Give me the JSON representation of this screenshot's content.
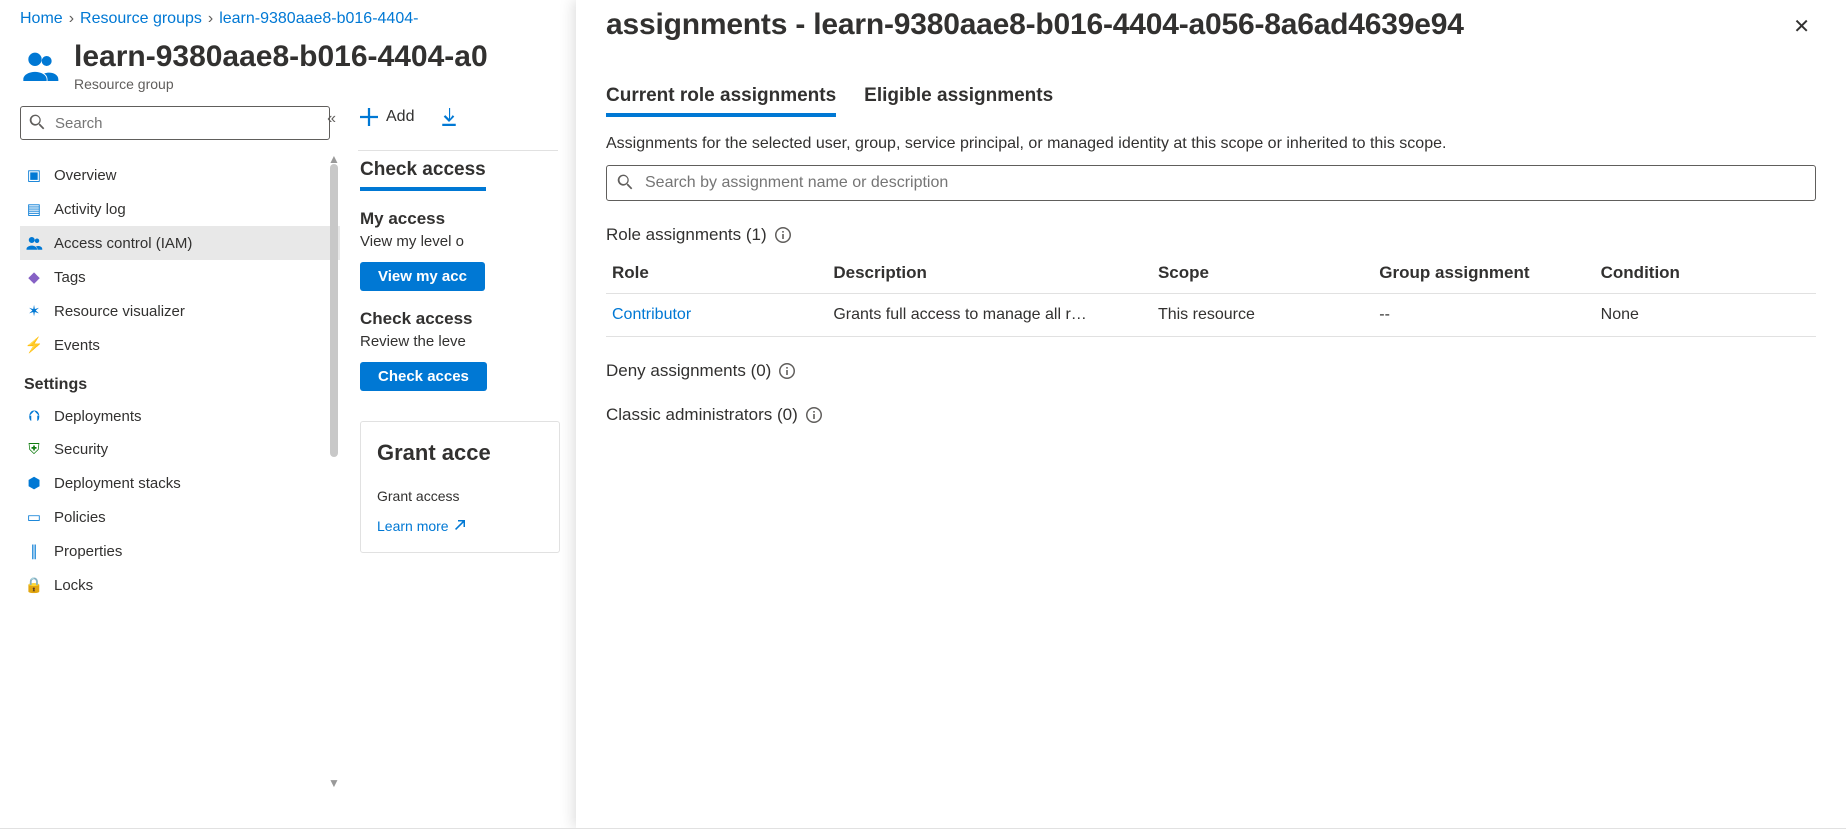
{
  "breadcrumb": {
    "home": "Home",
    "rg": "Resource groups",
    "current": "learn-9380aae8-b016-4404-"
  },
  "page": {
    "title": "learn-9380aae8-b016-4404-a0",
    "subtitle": "Resource group",
    "search_placeholder": "Search"
  },
  "sidebar": {
    "items": {
      "overview": "Overview",
      "activity": "Activity log",
      "iam": "Access control (IAM)",
      "tags": "Tags",
      "visualizer": "Resource visualizer",
      "events": "Events"
    },
    "settings_heading": "Settings",
    "settings_items": {
      "deployments": "Deployments",
      "security": "Security",
      "stacks": "Deployment stacks",
      "policies": "Policies",
      "properties": "Properties",
      "locks": "Locks"
    }
  },
  "toolbar": {
    "add": "Add"
  },
  "mid": {
    "tab": "Check access",
    "my_access_h": "My access",
    "my_access_p": "View my level o",
    "my_access_btn": "View my acc",
    "check_h": "Check access",
    "check_p": "Review the leve",
    "check_btn": "Check acces",
    "grant_h": "Grant acce",
    "grant_p": "Grant access ",
    "learn_more": "Learn more"
  },
  "panel": {
    "title": "assignments - learn-9380aae8-b016-4404-a056-8a6ad4639e94",
    "tabs": {
      "current": "Current role assignments",
      "eligible": "Eligible assignments"
    },
    "desc": "Assignments for the selected user, group, service principal, or managed identity at this scope or inherited to this scope.",
    "search_placeholder": "Search by assignment name or description",
    "role_heading": "Role assignments (1)",
    "deny_heading": "Deny assignments (0)",
    "classic_heading": "Classic administrators (0)",
    "table": {
      "headers": {
        "role": "Role",
        "desc": "Description",
        "scope": "Scope",
        "group": "Group assignment",
        "cond": "Condition"
      },
      "rows": [
        {
          "role": "Contributor",
          "desc": "Grants full access to manage all r…",
          "scope": "This resource",
          "group": "--",
          "cond": "None"
        }
      ]
    }
  }
}
